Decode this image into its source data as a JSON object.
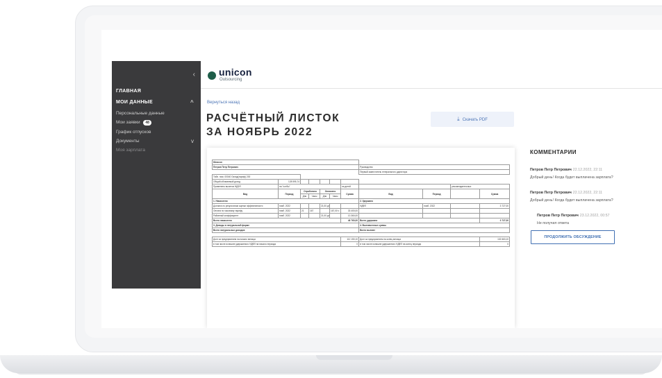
{
  "sidebar": {
    "collapse_glyph": "‹",
    "items": [
      {
        "label": "ГЛАВНАЯ"
      },
      {
        "label": "МОИ ДАННЫЕ",
        "chevron": "^"
      },
      {
        "label": "Персональные данные"
      },
      {
        "label": "Мои заявки",
        "badge": "48"
      },
      {
        "label": "График отпусков"
      },
      {
        "label": "Документы",
        "chevron": "v"
      },
      {
        "label": "Моя зарплата"
      }
    ]
  },
  "header": {
    "logo_text": "unicon",
    "logo_sub": "Outsourcing",
    "brand_color": "#1f5e4a"
  },
  "page": {
    "back_link": "Вернуться назад",
    "title_line1": "РАСЧЁТНЫЙ ЛИСТОК",
    "title_line2": "ЗА НОЯБРЬ 2022",
    "pdf_button": "Скачать PDF",
    "pdf_icon": "download-icon"
  },
  "payslip": {
    "org": "Юнисон",
    "employee": "Петров Петр Петрович",
    "tab_no": "Табл. ном. 00040 Оклад(тариф) 200",
    "total_income": "Общий облагаемый доход",
    "total_income_value": "128 595,74",
    "ndfl_deduction": "Применено вычетов НДФЛ",
    "ndfl_code": "на \"сотбы\"",
    "days": "на детей",
    "managers": "Руководство",
    "deputy": "Первый заместитель генерального директора",
    "dependents": "рекомендательных",
    "cols": {
      "type": "Вид",
      "period": "Период",
      "worked": "Отработано",
      "paid": "Оплачено",
      "days": "Дни",
      "hours": "Часы",
      "sum": "Сумма"
    },
    "section_accrued": "1. Начислено",
    "section_withheld": "2. Удержано",
    "rows": [
      {
        "type": "Доплата по результатам оценки эффективности",
        "period": "нояб. 2022",
        "pd": "21,00 дн",
        "ph": "",
        "sum": "",
        "w_type": "НДФЛ",
        "w_period": "нояб. 2022",
        "w_sum": "3 727,00"
      },
      {
        "type": "Оплата по часовому тарифу",
        "period": "нояб. 2022",
        "d": "21",
        "h": "167",
        "pd": "",
        "ph": "167,00 ч",
        "sum": "33 400,00",
        "w_type": "",
        "w_period": "",
        "w_sum": ""
      },
      {
        "type": "Районный коэффициент",
        "period": "нояб. 2022",
        "pd": "21,00 дн",
        "ph": "",
        "sum": "13 360,00",
        "w_type": "",
        "w_period": "",
        "w_sum": ""
      }
    ],
    "total_accrued": "Всего начислено",
    "total_accrued_value": "46 760,00",
    "total_withheld": "Всего удержано",
    "total_withheld_value": "3 727,00",
    "section_natural": "3. Доходы в натуральной форме",
    "section_paid": "4. Выплаченные суммы",
    "total_natural": "Всего натуральных доходов",
    "total_paid": "Всего выплат",
    "debt_start": "Долг за предприятием на начало месяца",
    "debt_start_value": "112 150,10",
    "debt_end": "Долг за предприятием на конец месяца",
    "debt_end_value": "132 663,10",
    "ndfl_start": "в том числе излишне удержанного НДФЛ на начало периода",
    "ndfl_start_value": "0",
    "ndfl_end": "в том числе излишне удержанного НДФЛ на конец периода",
    "ndfl_end_value": "0"
  },
  "comments": {
    "title": "КОММЕНТАРИИ",
    "items": [
      {
        "author": "Петров Петр Петрович",
        "date": "22.12.2022, 22:11",
        "text": "Добрый день! Когда будет выплачена зарплата?"
      },
      {
        "author": "Петров Петр Петрович",
        "date": "22.12.2022, 22:11",
        "text": "Добрый день! Когда будет выплачена зарплата?"
      },
      {
        "author": "Петров Петр Петрович",
        "date": "23.12.2022, 00:57",
        "text": "Не получил ответа"
      }
    ],
    "continue_button": "ПРОДОЛЖИТЬ ОБСУЖДЕНИЕ",
    "accent_color": "#3f6fb2"
  }
}
